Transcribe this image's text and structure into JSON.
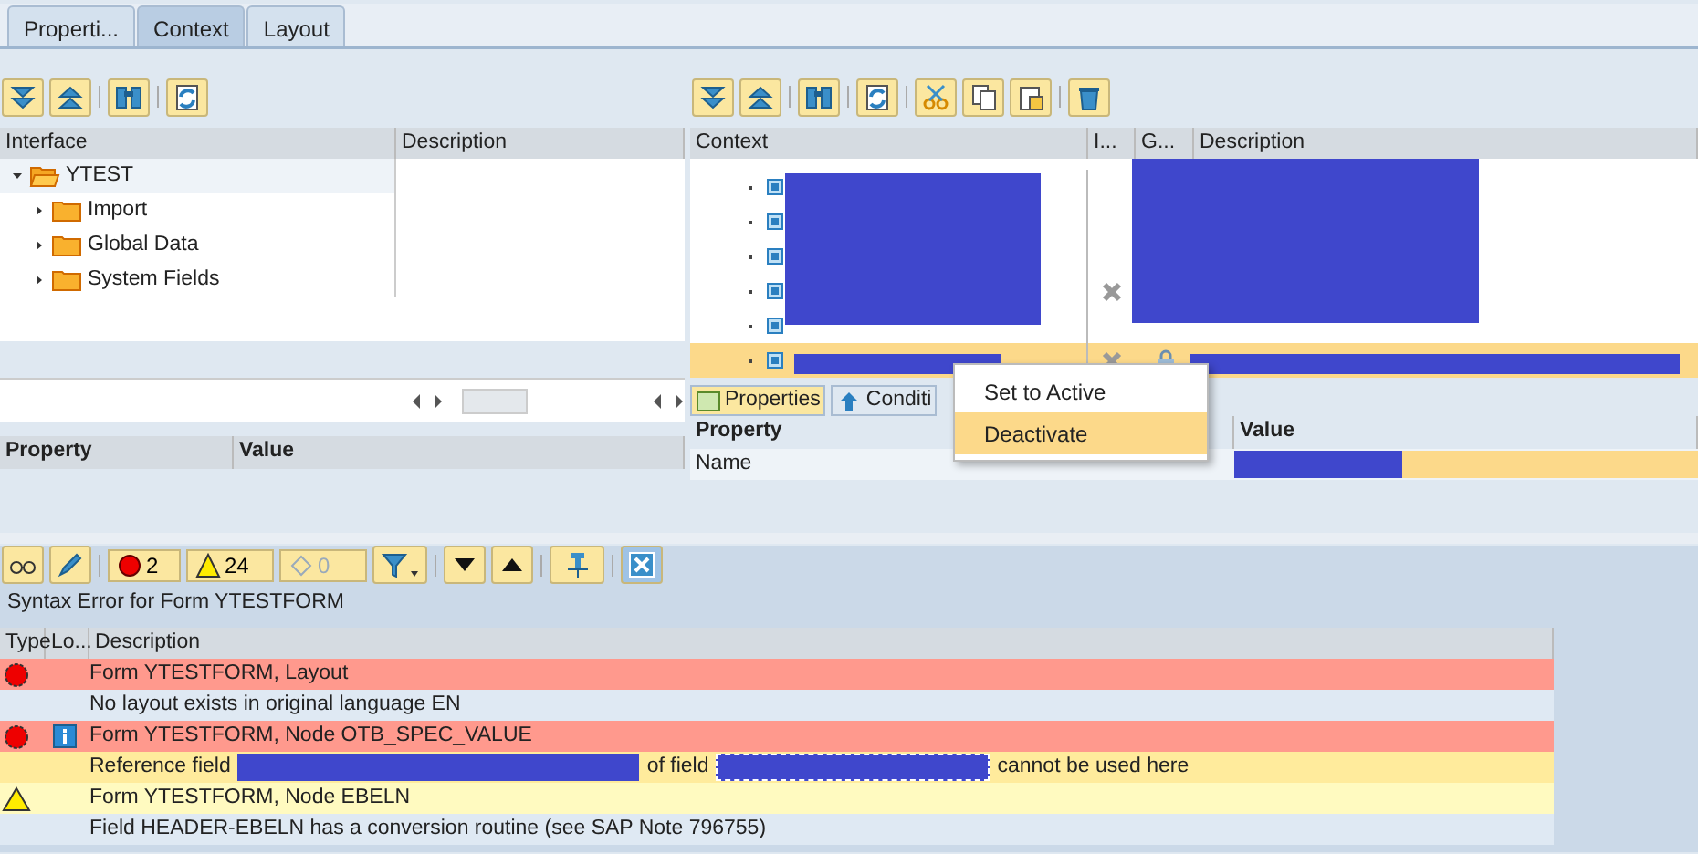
{
  "tabs": [
    {
      "label": "Properti...",
      "selected": false
    },
    {
      "label": "Context",
      "selected": true
    },
    {
      "label": "Layout",
      "selected": false
    }
  ],
  "interface_tree": {
    "columns": [
      "Interface",
      "Description"
    ],
    "items": [
      {
        "label": "YTEST",
        "expanded": true,
        "children": [
          {
            "label": "Import",
            "expanded": false
          },
          {
            "label": "Global Data",
            "expanded": false
          },
          {
            "label": "System Fields",
            "expanded": false
          }
        ]
      }
    ]
  },
  "interface_properties": {
    "columns": [
      "Property",
      "Value"
    ]
  },
  "context_tree": {
    "columns": [
      "Context",
      "I...",
      "G...",
      "Description"
    ],
    "rows": [
      {
        "inactive": false,
        "locked": false,
        "selected": false
      },
      {
        "inactive": false,
        "locked": false,
        "selected": false
      },
      {
        "inactive": false,
        "locked": false,
        "selected": false
      },
      {
        "inactive": true,
        "locked": false,
        "selected": false
      },
      {
        "inactive": false,
        "locked": false,
        "selected": false
      },
      {
        "inactive": true,
        "locked": true,
        "selected": true
      }
    ]
  },
  "context_tabs": [
    {
      "label": "Properties",
      "selected": true
    },
    {
      "label": "Conditi",
      "selected": false
    }
  ],
  "context_properties": {
    "columns": [
      "Property",
      "Value"
    ],
    "rows": [
      {
        "name": "Name"
      }
    ]
  },
  "context_menu": [
    {
      "label": "Set to Active",
      "selected": false
    },
    {
      "label": "Deactivate",
      "selected": true
    }
  ],
  "message_toolbar": {
    "errors": "2",
    "warnings": "24",
    "infos": "0"
  },
  "message_title": "Syntax Error for Form YTESTFORM",
  "messages": {
    "columns": [
      "Type",
      "Lo...",
      "Description"
    ],
    "rows": [
      {
        "kind": "error",
        "info": false,
        "selected": false,
        "parts": [
          "Form YTESTFORM, Layout"
        ]
      },
      {
        "kind": "detail",
        "info": false,
        "selected": false,
        "parts": [
          "No layout exists in original language EN"
        ]
      },
      {
        "kind": "error",
        "info": true,
        "selected": false,
        "parts": [
          "Form YTESTFORM, Node OTB_SPEC_VALUE"
        ]
      },
      {
        "kind": "detail",
        "info": false,
        "selected": true,
        "parts": [
          "Reference field",
          "of field",
          "cannot be used here"
        ]
      },
      {
        "kind": "warning",
        "info": false,
        "selected": false,
        "parts": [
          "Form YTESTFORM, Node EBELN"
        ]
      },
      {
        "kind": "detail",
        "info": false,
        "selected": false,
        "parts": [
          "Field HEADER-EBELN has a conversion routine (see SAP Note 796755)"
        ]
      }
    ]
  }
}
